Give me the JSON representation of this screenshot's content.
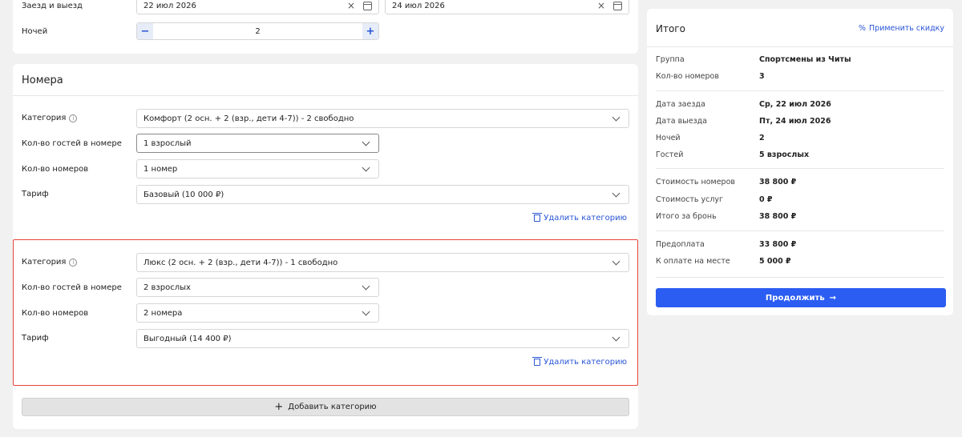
{
  "dates": {
    "checkin_label": "Заезд и выезд",
    "checkin_value": "22 июл 2026",
    "checkout_value": "24 июл 2026",
    "nights_label": "Ночей",
    "nights_value": "2",
    "minus": "−",
    "plus": "+",
    "clear_symbol": "×"
  },
  "rooms": {
    "title": "Номера",
    "labels": {
      "category": "Категория",
      "guests": "Кол-во гостей в номере",
      "count": "Кол-во номеров",
      "tariff": "Тариф"
    },
    "info_symbol": "i",
    "blocks": [
      {
        "category": "Комфорт (2 осн. + 2 (взр., дети 4-7)) - 2 свободно",
        "guests": "1 взрослый",
        "count": "1 номер",
        "tariff": "Базовый (10 000 ₽)",
        "delete": "Удалить категорию"
      },
      {
        "category": "Люкс (2 осн. + 2 (взр., дети 4-7)) - 1 свободно",
        "guests": "2 взрослых",
        "count": "2 номера",
        "tariff": "Выгодный (14 400 ₽)",
        "delete": "Удалить категорию"
      }
    ],
    "add_symbol": "+",
    "add_label": "Добавить категорию"
  },
  "summary": {
    "title": "Итого",
    "discount_symbol": "%",
    "discount_label": "Применить скидку",
    "rows": [
      {
        "k": "Группа",
        "v": "Спортсмены из Читы"
      },
      {
        "k": "Кол-во номеров",
        "v": "3"
      },
      {
        "k": "Дата заезда",
        "v": "Ср, 22 июл 2026"
      },
      {
        "k": "Дата выезда",
        "v": "Пт, 24 июл 2026"
      },
      {
        "k": "Ночей",
        "v": "2"
      },
      {
        "k": "Гостей",
        "v": "5 взрослых"
      },
      {
        "k": "Стоимость номеров",
        "v": "38 800 ₽"
      },
      {
        "k": "Стоимость услуг",
        "v": "0 ₽"
      },
      {
        "k": "Итого за бронь",
        "v": "38 800 ₽"
      },
      {
        "k": "Предоплата",
        "v": "33 800 ₽"
      },
      {
        "k": "К оплате на месте",
        "v": "5 000 ₽"
      }
    ],
    "continue_label": "Продолжить",
    "continue_arrow": "→"
  },
  "colors": {
    "accent": "#2c5df2",
    "link": "#2955d6",
    "highlight": "#e8453c"
  }
}
